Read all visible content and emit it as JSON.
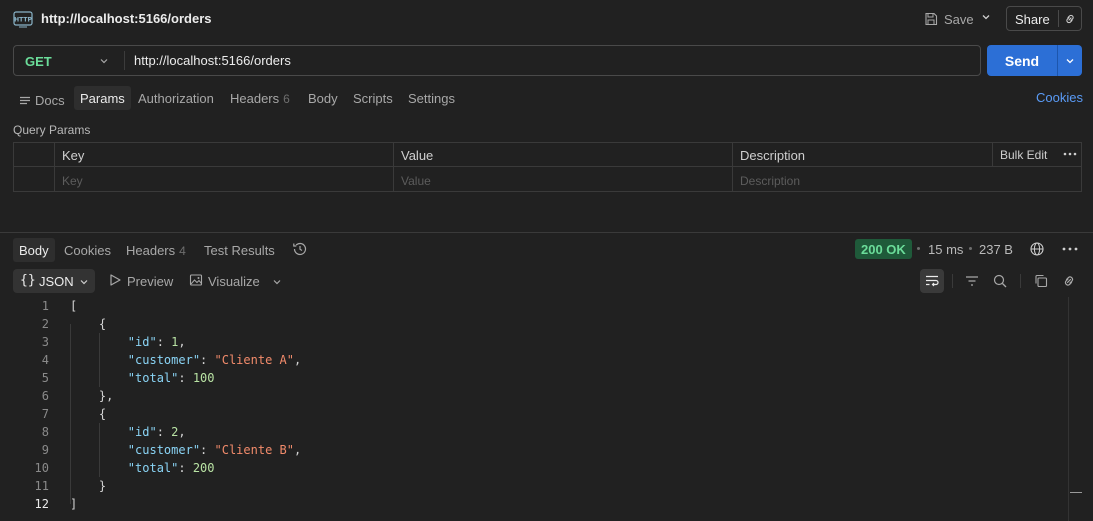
{
  "request": {
    "title": "http://localhost:5166/orders",
    "badge_label": "HTTP",
    "save_label": "Save",
    "share_label": "Share",
    "method": "GET",
    "url": "http://localhost:5166/orders",
    "send_label": "Send"
  },
  "request_tabs": [
    {
      "label": "Docs"
    },
    {
      "label": "Params",
      "active": true
    },
    {
      "label": "Authorization"
    },
    {
      "label": "Headers",
      "count": "6"
    },
    {
      "label": "Body"
    },
    {
      "label": "Scripts"
    },
    {
      "label": "Settings"
    }
  ],
  "cookies_label": "Cookies",
  "query_params": {
    "title": "Query Params",
    "columns": [
      "Key",
      "Value",
      "Description"
    ],
    "bulk_edit_label": "Bulk Edit",
    "placeholders": [
      "Key",
      "Value",
      "Description"
    ]
  },
  "response": {
    "tabs": [
      {
        "label": "Body",
        "active": true
      },
      {
        "label": "Cookies"
      },
      {
        "label": "Headers",
        "count": "4"
      },
      {
        "label": "Test Results"
      }
    ],
    "status": "200 OK",
    "time": "15 ms",
    "size": "237 B",
    "format": "JSON",
    "format_braces": "{}",
    "preview_label": "Preview",
    "visualize_label": "Visualize"
  },
  "code_lines": [
    {
      "n": "1",
      "text": "["
    },
    {
      "n": "2",
      "text": "    {"
    },
    {
      "n": "3",
      "text": "        \"id\": 1,"
    },
    {
      "n": "4",
      "text": "        \"customer\": \"Cliente A\","
    },
    {
      "n": "5",
      "text": "        \"total\": 100"
    },
    {
      "n": "6",
      "text": "    },"
    },
    {
      "n": "7",
      "text": "    {"
    },
    {
      "n": "8",
      "text": "        \"id\": 2,"
    },
    {
      "n": "9",
      "text": "        \"customer\": \"Cliente B\","
    },
    {
      "n": "10",
      "text": "        \"total\": 200"
    },
    {
      "n": "11",
      "text": "    }"
    },
    {
      "n": "12",
      "text": "]"
    }
  ],
  "colors": {
    "background": "#212121",
    "accent": "#2c6fd6",
    "method_get": "#6bdd9a",
    "status_ok_bg": "#1f5a3a",
    "json_key": "#8ad4f5",
    "json_string": "#f28b6b",
    "json_number": "#b9e3a4",
    "link": "#5a9bf6"
  },
  "icons": [
    "http-badge-icon",
    "save-icon",
    "chevron-down-icon",
    "link-icon",
    "docs-icon",
    "history-icon",
    "globe-icon",
    "more-icon",
    "preview-icon",
    "visualize-icon",
    "wrap-lines-icon",
    "filter-icon",
    "search-icon",
    "copy-icon"
  ]
}
